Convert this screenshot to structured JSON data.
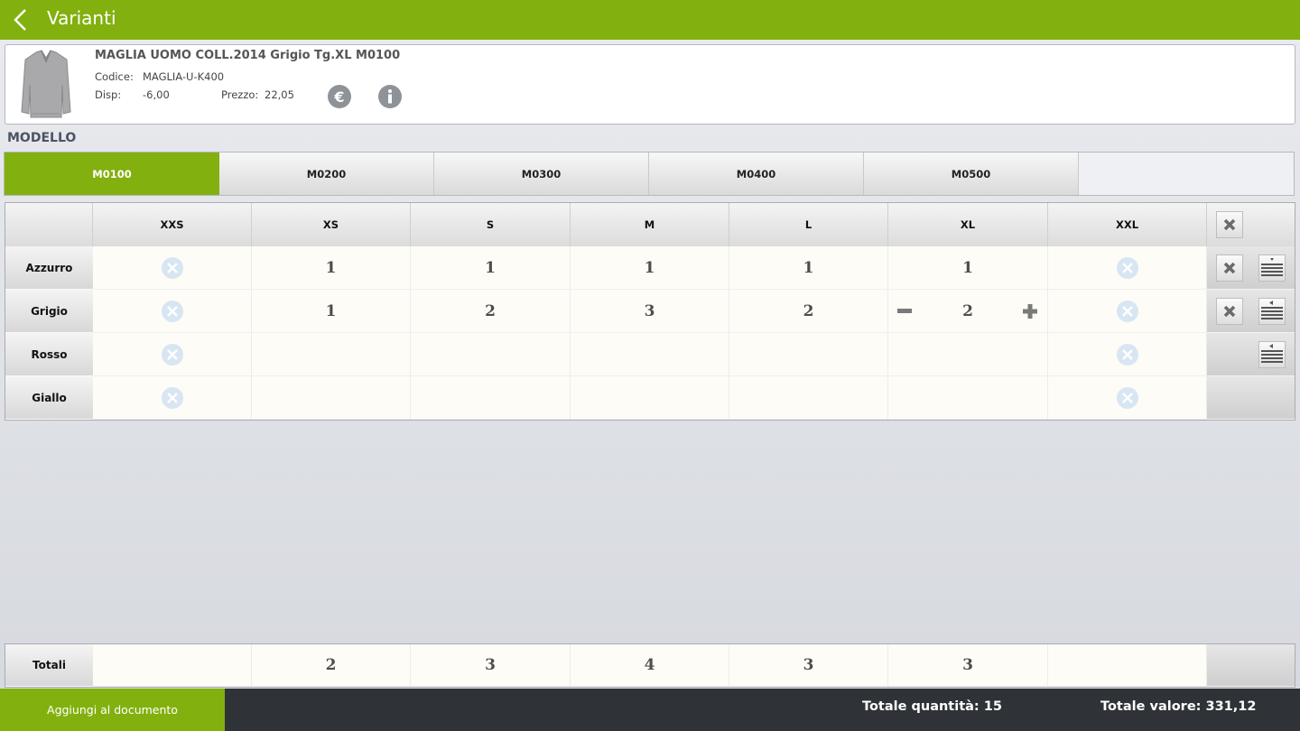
{
  "header": {
    "title": "Varianti"
  },
  "product": {
    "name": "MAGLIA UOMO COLL.2014 Grigio Tg.XL M0100",
    "codice_label": "Codice:",
    "codice_value": "MAGLIA-U-K400",
    "disp_label": "Disp:",
    "disp_value": "-6,00",
    "prezzo_label": "Prezzo:",
    "prezzo_value": "22,05"
  },
  "section": {
    "title": "MODELLO"
  },
  "tabs": [
    {
      "label": "M0100",
      "active": true
    },
    {
      "label": "M0200",
      "active": false
    },
    {
      "label": "M0300",
      "active": false
    },
    {
      "label": "M0400",
      "active": false
    },
    {
      "label": "M0500",
      "active": false
    }
  ],
  "grid": {
    "sizes": [
      "XXS",
      "XS",
      "S",
      "M",
      "L",
      "XL",
      "XXL"
    ],
    "rows": [
      {
        "label": "Azzurro",
        "values": [
          "",
          "1",
          "1",
          "1",
          "1",
          "1",
          ""
        ]
      },
      {
        "label": "Grigio",
        "values": [
          "",
          "1",
          "2",
          "3",
          "2",
          "2",
          ""
        ]
      },
      {
        "label": "Rosso",
        "values": [
          "",
          "",
          "",
          "",
          "",
          "",
          ""
        ]
      },
      {
        "label": "Giallo",
        "values": [
          "",
          "",
          "",
          "",
          "",
          "",
          ""
        ]
      }
    ],
    "unavailable_sizes": [
      "XXS",
      "XXL"
    ]
  },
  "totals": {
    "label": "Totali",
    "values": [
      "",
      "2",
      "3",
      "4",
      "3",
      "3",
      ""
    ]
  },
  "footer": {
    "add_button": "Aggiungi al documento",
    "total_quantity": "Totale quantità: 15",
    "total_value": "Totale valore: 331,12"
  },
  "colors": {
    "accent": "#82b00f",
    "footer_bg": "#2f3337",
    "unavailable_icon": "#d7e6f2"
  },
  "icons": [
    "back-chevron-icon",
    "euro-icon",
    "info-icon",
    "unavailable-icon",
    "close-icon",
    "minus-icon",
    "plus-icon",
    "list-expand-icon",
    "list-collapse-icon"
  ]
}
